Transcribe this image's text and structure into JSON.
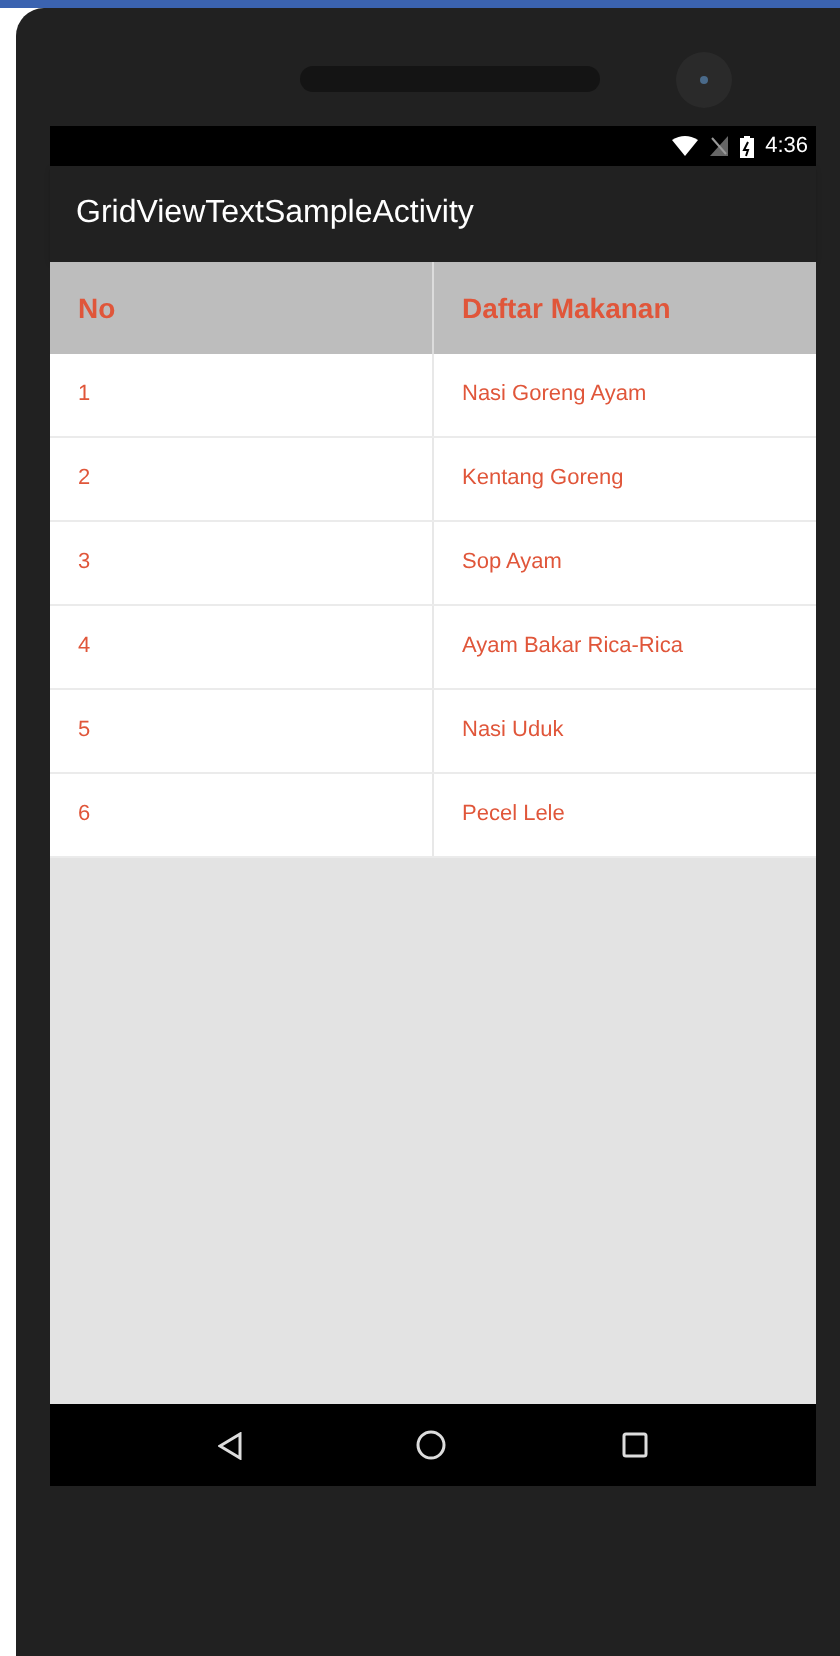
{
  "status_bar": {
    "time": "4:36"
  },
  "app_bar": {
    "title": "GridViewTextSampleActivity"
  },
  "table": {
    "columns": [
      "No",
      "Daftar Makanan"
    ],
    "rows": [
      [
        "1",
        "Nasi Goreng Ayam"
      ],
      [
        "2",
        "Kentang Goreng"
      ],
      [
        "3",
        "Sop Ayam"
      ],
      [
        "4",
        "Ayam Bakar Rica-Rica"
      ],
      [
        "5",
        "Nasi Uduk"
      ],
      [
        "6",
        "Pecel Lele"
      ]
    ]
  }
}
